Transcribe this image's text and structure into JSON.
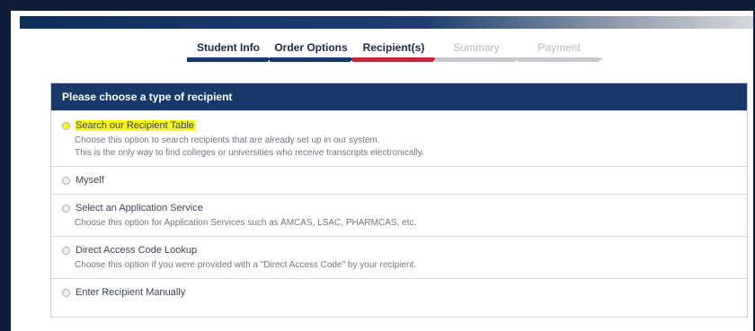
{
  "steps": [
    {
      "label": "Student Info",
      "state": "done"
    },
    {
      "label": "Order Options",
      "state": "done"
    },
    {
      "label": "Recipient(s)",
      "state": "current"
    },
    {
      "label": "Summary",
      "state": "todo"
    },
    {
      "label": "Payment",
      "state": "todo"
    }
  ],
  "panel": {
    "title": "Please choose a type of recipient",
    "options": [
      {
        "label": "Search our Recipient Table",
        "highlighted": true,
        "desc1": "Choose this option to search recipients that are already set up in our system.",
        "desc2": "This is the only way to find colleges or universities who receive transcripts electronically."
      },
      {
        "label": "Myself"
      },
      {
        "label": "Select an Application Service",
        "desc1": "Choose this option for Application Services such as AMCAS, LSAC, PHARMCAS, etc."
      },
      {
        "label": "Direct Access Code Lookup",
        "desc1": "Choose this option if you were provided with a \"Direct Access Code\" by your recipient."
      },
      {
        "label": "Enter Recipient Manually"
      }
    ]
  },
  "colors": {
    "navy": "#183a6b",
    "current_step": "#c2283a",
    "inactive_step": "#c8c9cc",
    "highlight": "#f8f51e"
  }
}
